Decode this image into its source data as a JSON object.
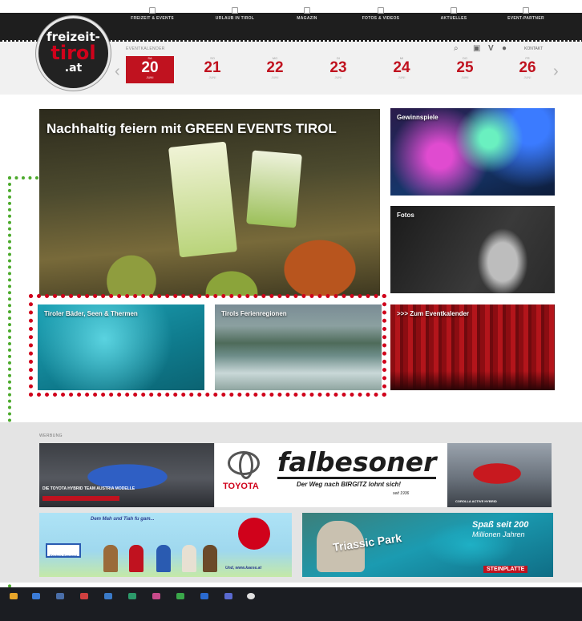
{
  "nav": {
    "items": [
      {
        "label": "FREIZEIT & EVENTS",
        "icon": "calendar-icon"
      },
      {
        "label": "URLAUB IN TIROL",
        "icon": "mountain-icon"
      },
      {
        "label": "MAGAZIN",
        "icon": "document-icon"
      },
      {
        "label": "FOTOS & VIDEOS",
        "icon": "camera-icon"
      },
      {
        "label": "AKTUELLES",
        "icon": "megaphone-icon"
      },
      {
        "label": "EVENT-PARTNER",
        "icon": "partner-icon"
      }
    ]
  },
  "logo": {
    "line1": "freizeit-",
    "line2": "tirol",
    "line3": ".at"
  },
  "calendar": {
    "label": "EVENTKALENDER",
    "days": [
      {
        "weekday": "SA",
        "num": "20",
        "month": "JUNI",
        "active": true
      },
      {
        "weekday": "SO",
        "num": "21",
        "month": "JUNI",
        "active": false
      },
      {
        "weekday": "MO",
        "num": "22",
        "month": "JUNI",
        "active": false
      },
      {
        "weekday": "DI",
        "num": "23",
        "month": "JUNI",
        "active": false
      },
      {
        "weekday": "MI",
        "num": "24",
        "month": "JUNI",
        "active": false
      },
      {
        "weekday": "DO",
        "num": "25",
        "month": "JUNI",
        "active": false
      },
      {
        "weekday": "FR",
        "num": "26",
        "month": "JUNI",
        "active": false
      }
    ],
    "prev_arrow": "‹",
    "next_arrow": "›"
  },
  "utility": {
    "search": "⌕",
    "instagram": "▣",
    "vimeo": "V",
    "other": "●",
    "kontakt": "KONTAKT"
  },
  "tiles": {
    "hero": "Nachhaltig feiern mit GREEN EVENTS TIROL",
    "gewinnspiele": "Gewinnspiele",
    "fotos": "Fotos",
    "baeder": "Tiroler Bäder, Seen & Thermen",
    "ferien": "Tirols Ferienregionen",
    "kalender": ">>> Zum Eventkalender"
  },
  "ads": {
    "label": "WERBUNG",
    "car1_caption": "DIE TOYOTA HYBRID TEAM AUSTRIA MODELLE",
    "toyota_word": "TOYOTA",
    "falbesoner": "falbesoner",
    "falbesoner_sub": "Der Weg nach BIRGITZ lohnt sich!",
    "falbesoner_since": "seit 1936",
    "car2_caption": "COROLLA ACTIVE HYBRID",
    "erlebnis_head": "Dem Mah und Tiah fu gam...",
    "erlebnis_logo": "Erlebnis Sennerei",
    "erlebnis_foot": "Und, www.kaese.at",
    "triassic_word": "Triassic Park",
    "triassic_spass": "Spaß seit 200",
    "triassic_sub": "Millionen Jahren",
    "triassic_brand": "STEINPLATTE"
  },
  "colors": {
    "accent": "#c0121f",
    "nav_bg": "#1e1e1e",
    "annotation_red": "#d0021b",
    "annotation_green": "#4caa2c"
  }
}
